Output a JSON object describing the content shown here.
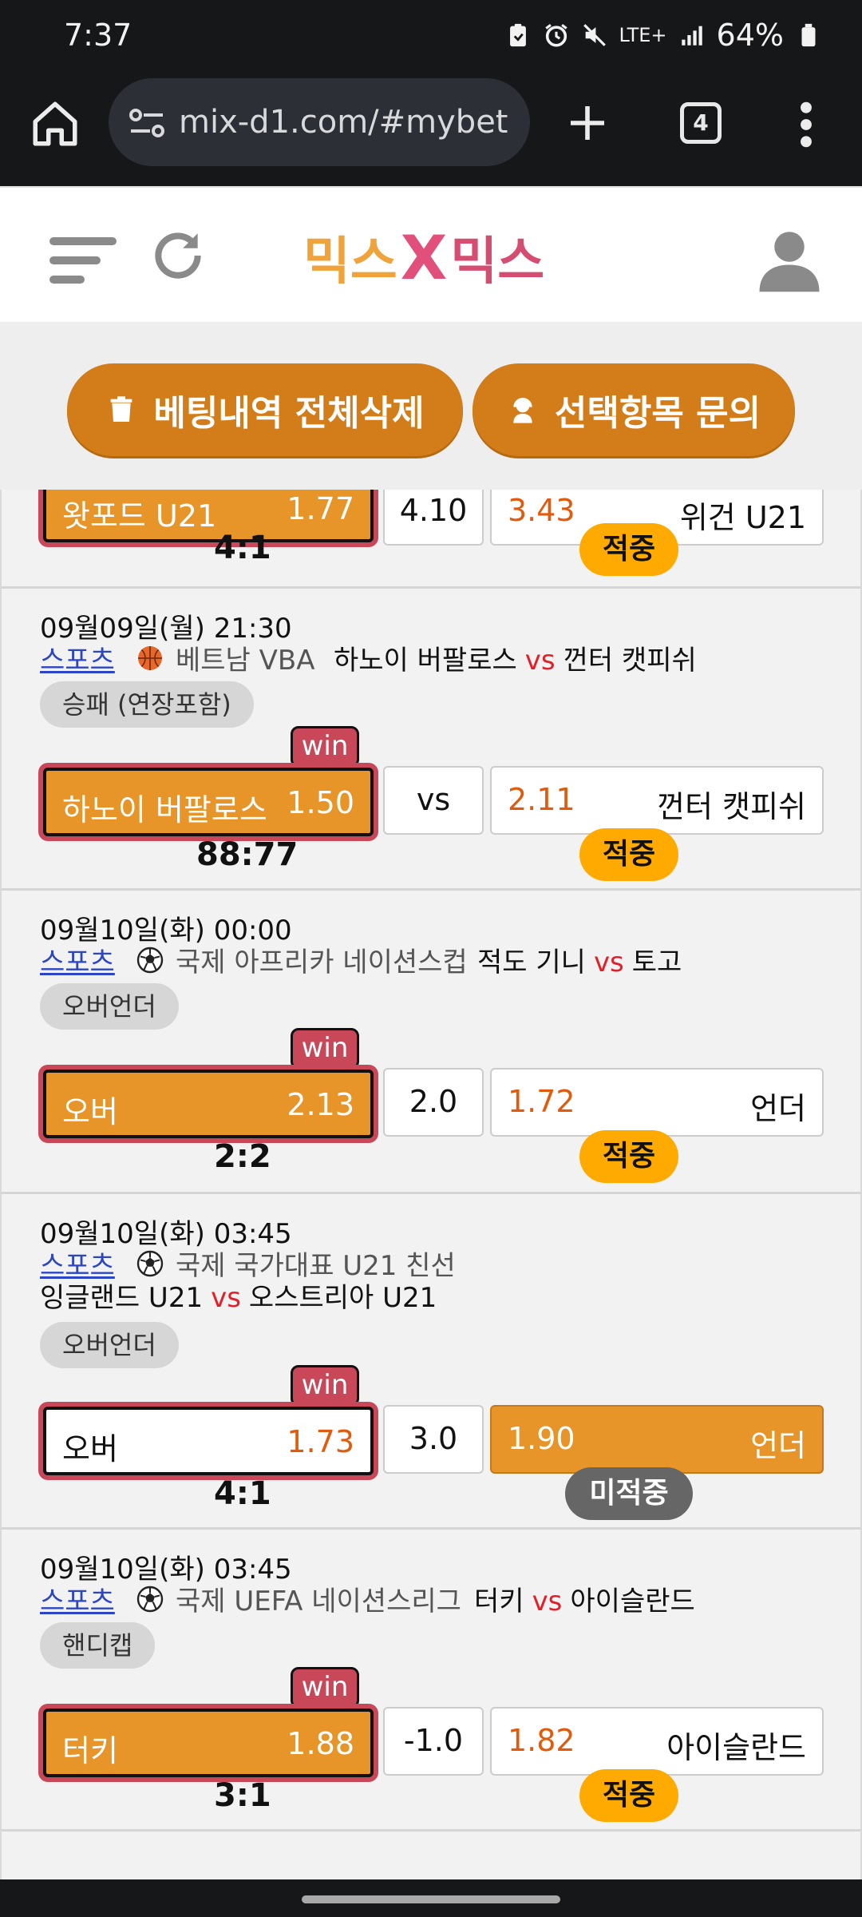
{
  "status": {
    "time": "7:37",
    "network": "LTE+",
    "battery": "64%"
  },
  "browser": {
    "url": "mix-d1.com/#mybet",
    "tab_count": "4"
  },
  "app": {
    "logo_left": "믹스",
    "logo_x": "X",
    "logo_right": "믹스"
  },
  "actions": {
    "delete_all": "베팅내역 전체삭제",
    "inquiry": "선택항목 문의"
  },
  "cards": [
    {
      "home": "왓포드 U21",
      "home_odd": "1.77",
      "mid": "4.10",
      "away_odd": "3.43",
      "away": "위건 U21",
      "score": "4:1",
      "result": "적중"
    },
    {
      "date": "09월09일(월) 21:30",
      "sport": "스포츠",
      "league": "베트남 VBA",
      "team_home": "하노이 버팔로스",
      "vs": "vs",
      "team_away": "껀터 캣피쉬",
      "market": "승패 (연장포함)",
      "win": "win",
      "home": "하노이 버팔로스",
      "home_odd": "1.50",
      "mid": "vs",
      "away_odd": "2.11",
      "away": "껀터 캣피쉬",
      "score": "88:77",
      "result": "적중"
    },
    {
      "date": "09월10일(화) 00:00",
      "sport": "스포츠",
      "league": "국제 아프리카 네이션스컵",
      "team_home": "적도 기니",
      "vs": "vs",
      "team_away": "토고",
      "market": "오버언더",
      "win": "win",
      "home": "오버",
      "home_odd": "2.13",
      "mid": "2.0",
      "away_odd": "1.72",
      "away": "언더",
      "score": "2:2",
      "result": "적중"
    },
    {
      "date": "09월10일(화) 03:45",
      "sport": "스포츠",
      "league": "국제 국가대표 U21 친선",
      "team_home": "잉글랜드 U21",
      "vs": "vs",
      "team_away": "오스트리아 U21",
      "market": "오버언더",
      "win": "win",
      "home": "오버",
      "home_odd": "1.73",
      "mid": "3.0",
      "away_odd": "1.90",
      "away": "언더",
      "score": "4:1",
      "result": "미적중"
    },
    {
      "date": "09월10일(화) 03:45",
      "sport": "스포츠",
      "league": "국제 UEFA 네이션스리그",
      "team_home": "터키",
      "vs": "vs",
      "team_away": "아이슬란드",
      "market": "핸디캡",
      "win": "win",
      "home": "터키",
      "home_odd": "1.88",
      "mid": "-1.0",
      "away_odd": "1.82",
      "away": "아이슬란드",
      "score": "3:1",
      "result": "적중"
    }
  ],
  "colors": {
    "accent": "#d27d1a",
    "selected": "#e79428",
    "win_badge": "#c8485a",
    "hit": "#ffaa00",
    "miss": "#666666",
    "odd": "#e25a0c",
    "sport_link": "#2b45c6",
    "vs": "#e2202a"
  }
}
